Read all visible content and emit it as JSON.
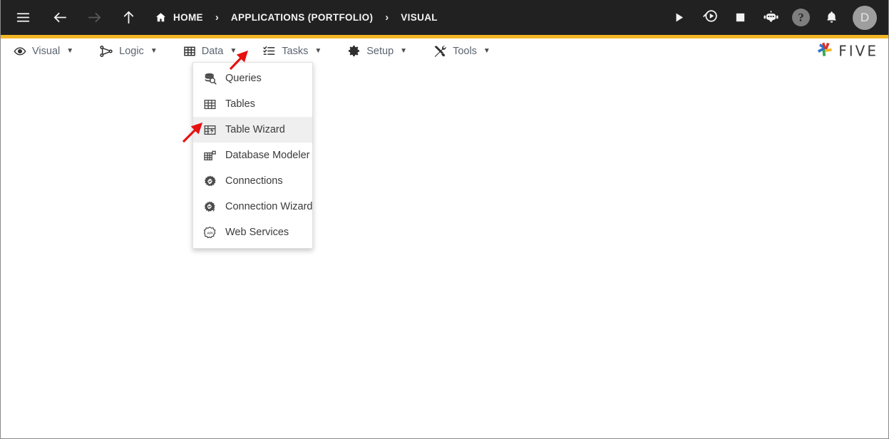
{
  "window": {
    "accent_gold": "#f2b627",
    "topbar_bg": "#212121",
    "highlight_bg": "#efefef",
    "arrow_color": "#e81010"
  },
  "topbar": {
    "hamburger_icon": "hamburger-menu-icon",
    "back_icon": "arrow-left-icon",
    "forward_icon": "arrow-right-icon",
    "up_icon": "arrow-up-icon",
    "breadcrumb": [
      {
        "label": "HOME",
        "icon": "home-icon"
      },
      {
        "label": "APPLICATIONS (PORTFOLIO)",
        "icon": ""
      },
      {
        "label": "VISUAL",
        "icon": ""
      }
    ],
    "separator": "›",
    "actions": [
      {
        "name": "run-button",
        "icon": "play-icon"
      },
      {
        "name": "debug-button",
        "icon": "play-search-icon"
      },
      {
        "name": "stop-button",
        "icon": "stop-square-icon"
      },
      {
        "name": "assistant-button",
        "icon": "robot-icon"
      },
      {
        "name": "help-button",
        "icon": "question-mark-icon",
        "glyph": "?"
      },
      {
        "name": "notifications-button",
        "icon": "bell-icon"
      }
    ],
    "avatar": {
      "initial": "D",
      "bg": "#9e9e9e"
    }
  },
  "menubar": {
    "items": [
      {
        "label": "Visual",
        "icon": "eye-icon",
        "caret": "▼"
      },
      {
        "label": "Logic",
        "icon": "flow-nodes-icon",
        "caret": "▼"
      },
      {
        "label": "Data",
        "icon": "table-grid-icon",
        "caret": "▼"
      },
      {
        "label": "Tasks",
        "icon": "checklist-icon",
        "caret": "▼"
      },
      {
        "label": "Setup",
        "icon": "gear-icon",
        "caret": "▼"
      },
      {
        "label": "Tools",
        "icon": "wrench-screwdriver-icon",
        "caret": "▼"
      }
    ],
    "brand": {
      "text": "FIVE",
      "logo_icon": "five-pinwheel-logo",
      "logo_colors": [
        "#2f6fd0",
        "#d93025",
        "#f2b627",
        "#34a853"
      ]
    }
  },
  "dropdown": {
    "owner": "Data",
    "items": [
      {
        "label": "Queries",
        "icon": "database-search-icon",
        "active": false
      },
      {
        "label": "Tables",
        "icon": "table-grid-icon",
        "active": false
      },
      {
        "label": "Table Wizard",
        "icon": "table-wizard-icon",
        "active": true
      },
      {
        "label": "Database Modeler",
        "icon": "database-modeler-icon",
        "active": false
      },
      {
        "label": "Connections",
        "icon": "connection-gear-icon",
        "active": false
      },
      {
        "label": "Connection Wizard",
        "icon": "connection-wizard-icon",
        "active": false
      },
      {
        "label": "Web Services",
        "icon": "api-badge-icon",
        "active": false
      }
    ]
  },
  "annotations": [
    {
      "name": "arrow-to-data-menu",
      "target": "Data menu caret"
    },
    {
      "name": "arrow-to-table-wizard",
      "target": "Table Wizard item"
    }
  ]
}
